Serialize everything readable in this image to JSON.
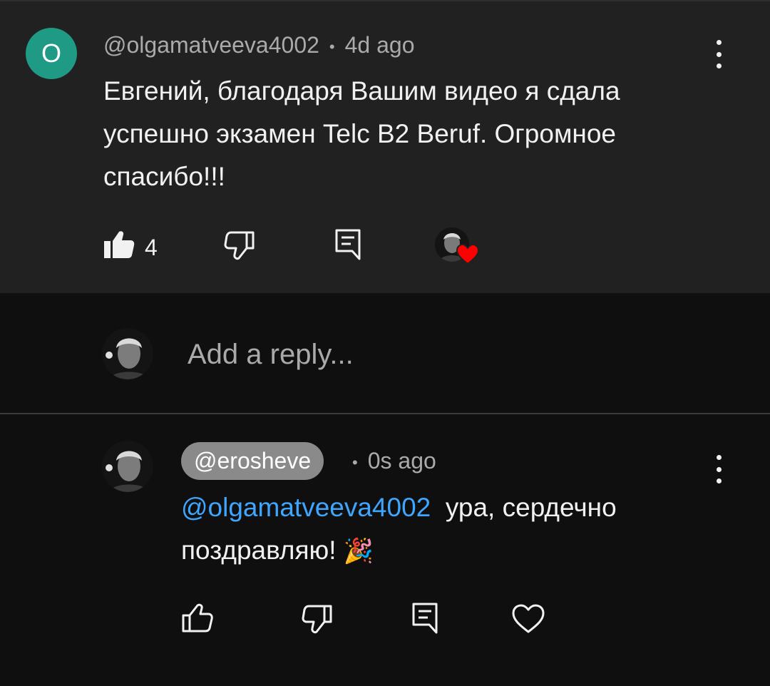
{
  "top_comment": {
    "avatar_letter": "O",
    "author": "@olgamatveeva4002",
    "separator": "•",
    "time": "4d ago",
    "text_lines": [
      "Евгений, благодаря Вашим видео я сдала",
      "успешно экзамен Telc B2 Beruf. Огромное",
      "спасибо!!!"
    ],
    "like_count": "4"
  },
  "reply_box": {
    "placeholder": "Add a reply..."
  },
  "reply": {
    "author": "@erosheve",
    "separator": "•",
    "time": "0s ago",
    "mention": "@olgamatveeva4002",
    "text_line1": "ура, сердечно",
    "text_line2": "поздравляю!",
    "emoji": "🎉"
  },
  "colors": {
    "top_bg": "#212121",
    "page_bg": "#0f0f0f",
    "avatar_bg": "#1e9a85",
    "mention": "#3ea6ff",
    "heart": "#ff0000"
  }
}
